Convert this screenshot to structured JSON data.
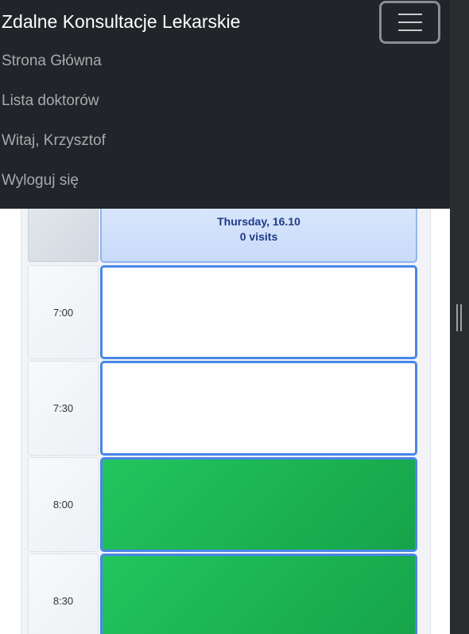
{
  "navbar": {
    "brand": "Zdalne Konsultacje Lekarskie",
    "toggler_icon": "hamburger-icon",
    "items": [
      {
        "label": "Strona Główna"
      },
      {
        "label": "Lista doktorów"
      },
      {
        "label": "Witaj, Krzysztof"
      },
      {
        "label": "Wyloguj się"
      }
    ]
  },
  "calendar": {
    "day": {
      "title": "Thursday, 16.10",
      "visits": "0 visits"
    },
    "slots": [
      {
        "time": "7:00",
        "status": "free"
      },
      {
        "time": "7:30",
        "status": "free"
      },
      {
        "time": "8:00",
        "status": "taken"
      },
      {
        "time": "8:30",
        "status": "taken"
      }
    ]
  },
  "colors": {
    "navbar_bg": "#212529",
    "slot_border": "#4a86e8",
    "slot_taken": "#22c55e",
    "day_header_text": "#1f3a8a"
  }
}
